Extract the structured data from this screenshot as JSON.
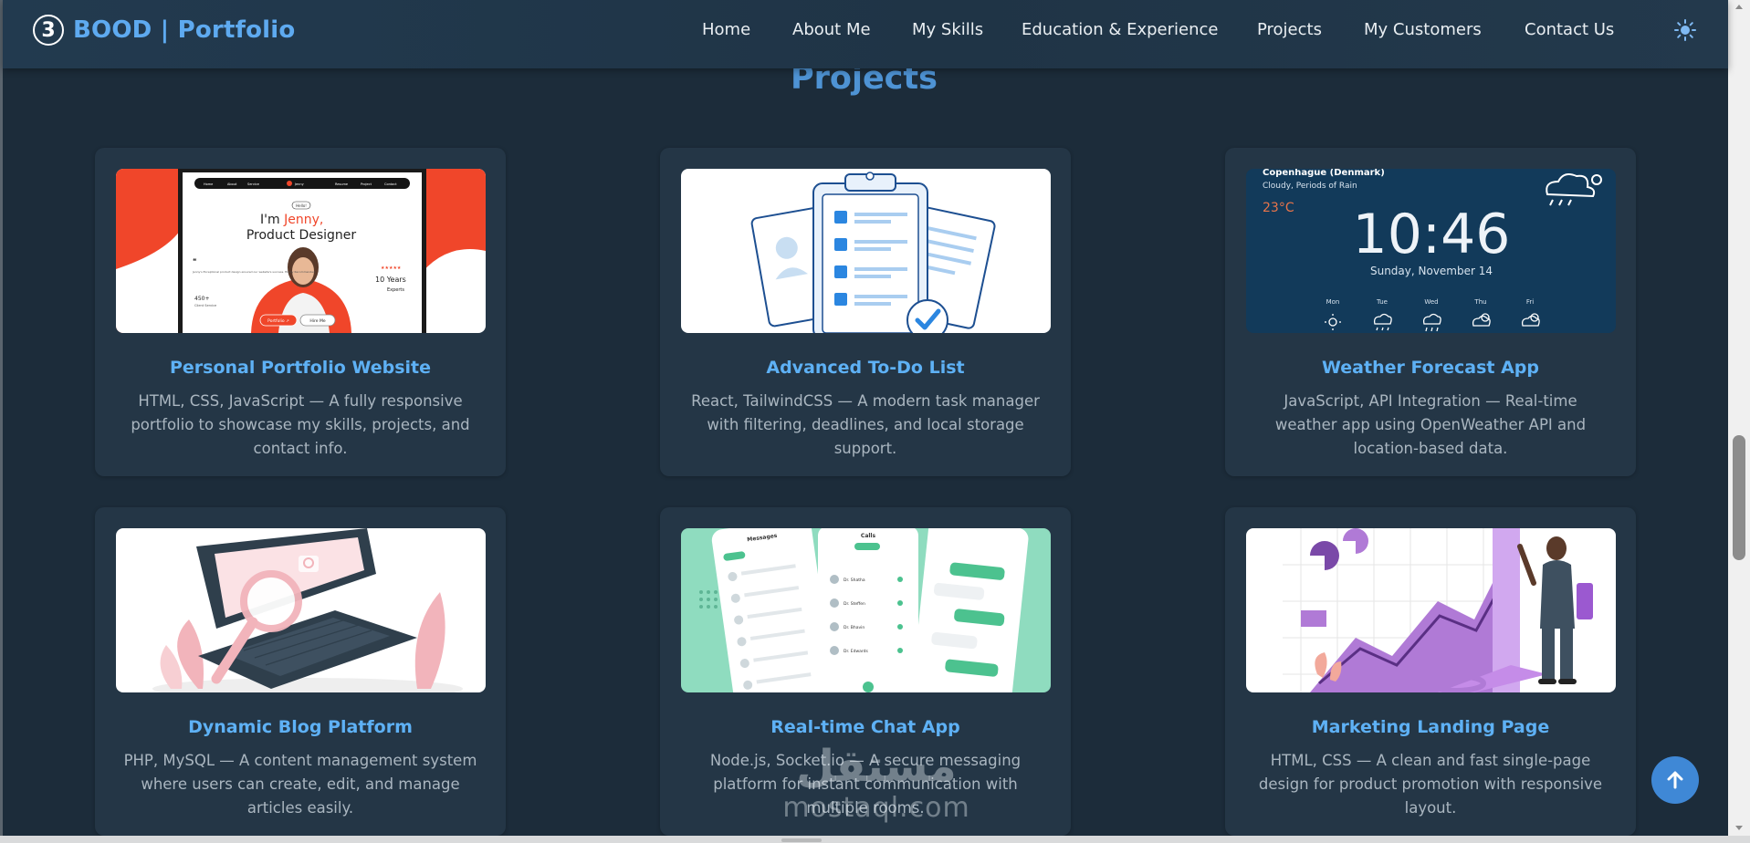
{
  "header": {
    "brand_badge": "3",
    "brand_text": "BOOD | Portfolio",
    "nav": [
      {
        "label": "Home"
      },
      {
        "label": "About Me"
      },
      {
        "label": "My Skills"
      },
      {
        "label": "Education & Experience"
      },
      {
        "label": "Projects"
      },
      {
        "label": "My Customers"
      },
      {
        "label": "Contact Us"
      }
    ],
    "theme_icon": "sun-icon"
  },
  "section": {
    "title": "Projects"
  },
  "projects": [
    {
      "title": "Personal Portfolio Website",
      "desc_lines": [
        "HTML, CSS, JavaScript — A fully responsive",
        "portfolio to showcase my skills, projects, and",
        "contact info."
      ],
      "thumb": {
        "nav_items": [
          "Home",
          "About",
          "Service",
          "Jenny",
          "Resume",
          "Project",
          "Contact"
        ],
        "hello": "Hello!",
        "headline_1": "I'm ",
        "headline_name": "Jenny,",
        "headline_2": "Product Designer",
        "quote_text": "Jenny's Exceptional product design ensured our website's success. Highly Recommended",
        "stars": "★★★★★",
        "years": "10 Years",
        "experts": "Experts",
        "stat_value": "450+",
        "stat_label": "Client Service",
        "btn_portfolio": "Portfolio ↗",
        "btn_hire": "Hire Me"
      }
    },
    {
      "title": "Advanced To-Do List",
      "desc_lines": [
        "React, TailwindCSS — A modern task manager",
        "with filtering, deadlines, and local storage",
        "support."
      ]
    },
    {
      "title": "Weather Forecast App",
      "desc_lines": [
        "JavaScript, API Integration — Real-time",
        "weather app using OpenWeather API and",
        "location-based data."
      ],
      "thumb": {
        "city": "Copenhague (Denmark)",
        "condition": "Cloudy, Periods of Rain",
        "temp": "23°C",
        "time": "10:46",
        "date": "Sunday, November 14",
        "days": [
          "Mon",
          "Tue",
          "Wed",
          "Thu",
          "Fri"
        ]
      }
    },
    {
      "title": "Dynamic Blog Platform",
      "desc_lines": [
        "PHP, MySQL — A content management system",
        "where users can create, edit, and manage",
        "articles easily."
      ]
    },
    {
      "title": "Real-time Chat App",
      "desc_lines": [
        "Node.js, Socket.io — A secure messaging",
        "platform for instant communication with",
        "multiple rooms."
      ],
      "thumb": {
        "screen1_title": "Messages",
        "screen2_title": "Calls",
        "contacts": [
          "Dr. Shatha",
          "Dr. Steffen",
          "Dr. Bhavin",
          "Dr. Edwards"
        ]
      }
    },
    {
      "title": "Marketing Landing Page",
      "desc_lines": [
        "HTML, CSS — A clean and fast single-page",
        "design for product promotion with responsive",
        "layout."
      ]
    }
  ],
  "watermark": {
    "arabic": "مستقل",
    "latin": "mostaql.com"
  },
  "colors": {
    "background": "#1c2c3a",
    "card": "#243646",
    "accent": "#5eb1f5",
    "title": "#4e93d4",
    "to_top_button": "#3f88d6"
  }
}
